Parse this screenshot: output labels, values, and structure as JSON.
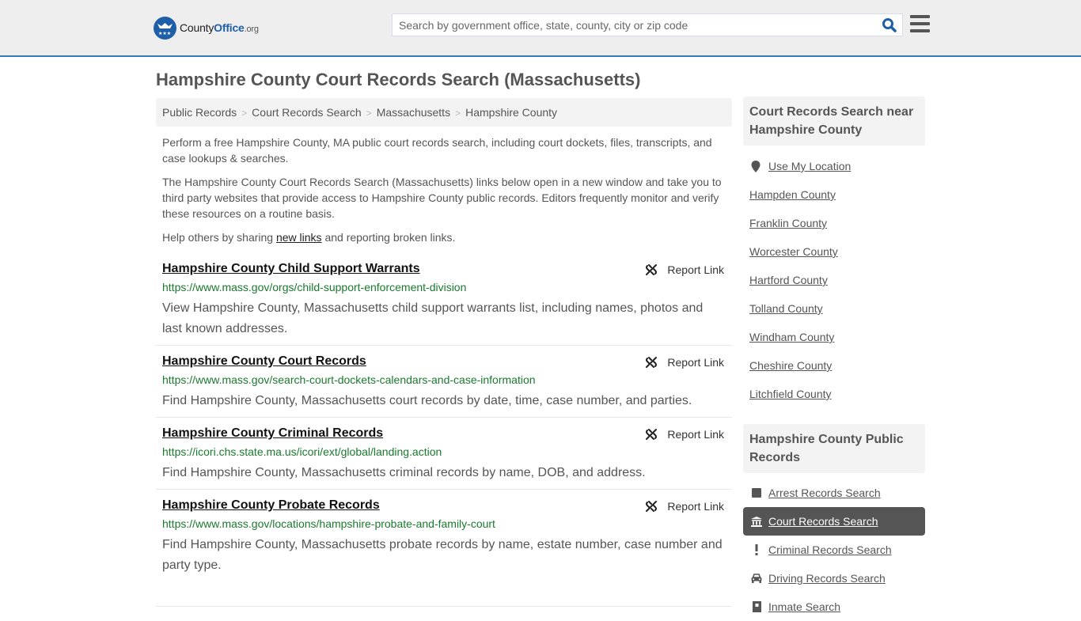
{
  "header": {
    "logo": {
      "brand_main": "County",
      "brand_accent": "Office",
      "brand_suffix": ".org"
    },
    "search": {
      "placeholder": "Search by government office, state, county, city or zip code",
      "value": ""
    },
    "icons": {
      "search": "search-icon",
      "menu": "hamburger-menu-icon"
    }
  },
  "page": {
    "title": "Hampshire County Court Records Search (Massachusetts)",
    "breadcrumb": [
      "Public Records",
      "Court Records Search",
      "Massachusetts",
      "Hampshire County"
    ],
    "intro": {
      "p1": "Perform a free Hampshire County, MA public court records search, including court dockets, files, transcripts, and case lookups & searches.",
      "p2": "The Hampshire County Court Records Search (Massachusetts) links below open in a new window and take you to third party websites that provide access to Hampshire County public records. Editors frequently monitor and verify these resources on a routine basis.",
      "p3_before": "Help others by sharing ",
      "p3_link": "new links",
      "p3_after": " and reporting broken links."
    },
    "report_label": "Report Link",
    "results": [
      {
        "title": "Hampshire County Child Support Warrants",
        "url": "https://www.mass.gov/orgs/child-support-enforcement-division",
        "description": "View Hampshire County, Massachusetts child support warrants list, including names, photos and last known addresses."
      },
      {
        "title": "Hampshire County Court Records",
        "url": "https://www.mass.gov/search-court-dockets-calendars-and-case-information",
        "description": "Find Hampshire County, Massachusetts court records by date, time, case number, and parties."
      },
      {
        "title": "Hampshire County Criminal Records",
        "url": "https://icori.chs.state.ma.us/icori/ext/global/landing.action",
        "description": "Find Hampshire County, Massachusetts criminal records by name, DOB, and address."
      },
      {
        "title": "Hampshire County Probate Records",
        "url": "https://www.mass.gov/locations/hampshire-probate-and-family-court",
        "description": "Find Hampshire County, Massachusetts probate records by name, estate number, case number and party type."
      }
    ]
  },
  "sidebar": {
    "nearby": {
      "heading": "Court Records Search near Hampshire County",
      "use_location": "Use My Location",
      "counties": [
        "Hampden County",
        "Franklin County",
        "Worcester County",
        "Hartford County",
        "Tolland County",
        "Windham County",
        "Cheshire County",
        "Litchfield County"
      ]
    },
    "public_records": {
      "heading": "Hampshire County Public Records",
      "items": [
        {
          "label": "Arrest Records Search",
          "icon": "square-icon",
          "active": false
        },
        {
          "label": "Court Records Search",
          "icon": "courthouse-icon",
          "active": true
        },
        {
          "label": "Criminal Records Search",
          "icon": "exclamation-icon",
          "active": false
        },
        {
          "label": "Driving Records Search",
          "icon": "car-icon",
          "active": false
        },
        {
          "label": "Inmate Search",
          "icon": "jail-icon",
          "active": false
        }
      ]
    }
  },
  "colors": {
    "accent": "#337ab7",
    "logo_blue": "#1f5fa8",
    "url_green": "#1a7a2e",
    "active_bg": "#555555"
  }
}
